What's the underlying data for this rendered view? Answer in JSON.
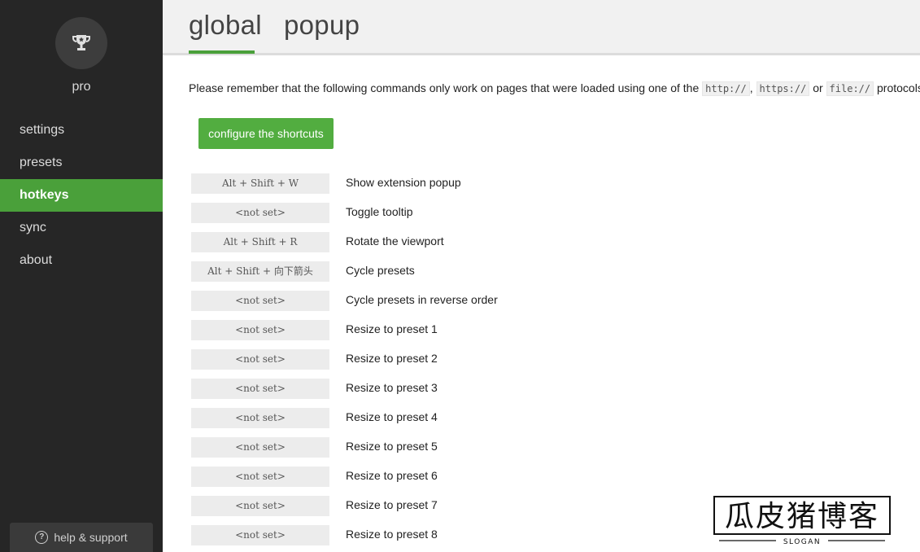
{
  "sidebar": {
    "avatar_icon": "trophy-icon",
    "pro_label": "pro",
    "items": [
      {
        "label": "settings",
        "active": false
      },
      {
        "label": "presets",
        "active": false
      },
      {
        "label": "hotkeys",
        "active": true
      },
      {
        "label": "sync",
        "active": false
      },
      {
        "label": "about",
        "active": false
      }
    ],
    "help_label": "help & support",
    "help_icon": "question-circle-icon"
  },
  "header": {
    "tabs": [
      {
        "label": "global",
        "active": true
      },
      {
        "label": "popup",
        "active": false
      }
    ]
  },
  "main": {
    "notice_prefix": "Please remember that the following commands only work on pages that were loaded using one of the ",
    "protocol_http": "http://",
    "sep1": ", ",
    "protocol_https": "https://",
    "sep2": " or ",
    "protocol_file": "file://",
    "notice_suffix": " protocols.",
    "configure_label": "configure the shortcuts",
    "shortcuts": [
      {
        "key": "Alt + Shift + W",
        "desc": "Show extension popup"
      },
      {
        "key": "<not set>",
        "desc": "Toggle tooltip"
      },
      {
        "key": "Alt + Shift + R",
        "desc": "Rotate the viewport"
      },
      {
        "key": "Alt + Shift + 向下箭头",
        "desc": "Cycle presets"
      },
      {
        "key": "<not set>",
        "desc": "Cycle presets in reverse order"
      },
      {
        "key": "<not set>",
        "desc": "Resize to preset 1"
      },
      {
        "key": "<not set>",
        "desc": "Resize to preset 2"
      },
      {
        "key": "<not set>",
        "desc": "Resize to preset 3"
      },
      {
        "key": "<not set>",
        "desc": "Resize to preset 4"
      },
      {
        "key": "<not set>",
        "desc": "Resize to preset 5"
      },
      {
        "key": "<not set>",
        "desc": "Resize to preset 6"
      },
      {
        "key": "<not set>",
        "desc": "Resize to preset 7"
      },
      {
        "key": "<not set>",
        "desc": "Resize to preset 8"
      }
    ]
  },
  "watermark": {
    "title": "瓜皮猪博客",
    "slogan": "SLOGAN"
  },
  "colors": {
    "sidebar_bg": "#262626",
    "accent": "#4aa03a",
    "button": "#52ad40"
  }
}
